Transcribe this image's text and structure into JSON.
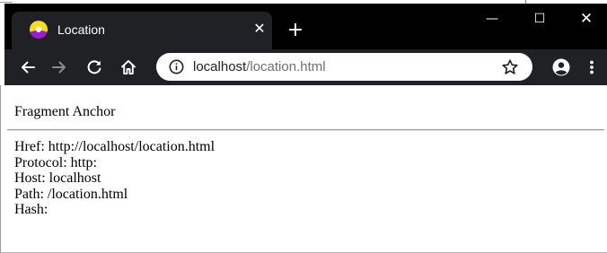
{
  "browser": {
    "tab": {
      "title": "Location",
      "favicon": "color-wheel-icon",
      "close_icon": "close-icon"
    },
    "new_tab_icon": "plus-icon",
    "window_controls": {
      "minimize": "—",
      "maximize": "☐",
      "close": "✕"
    },
    "toolbar": {
      "back_icon": "arrow-left-icon",
      "forward_icon": "arrow-right-icon",
      "reload_icon": "reload-icon",
      "home_icon": "home-icon",
      "info_icon": "info-icon",
      "bookmark_icon": "star-icon",
      "profile_icon": "account-circle-icon",
      "menu_icon": "vertical-dots-icon"
    },
    "address_bar": {
      "host": "localhost",
      "path": "/location.html"
    },
    "colors": {
      "titlebar": "#000000",
      "toolbar": "#202124",
      "omnibox": "#ffffff",
      "favicon_yellow": "#f7dd2b",
      "favicon_purple": "#9b1fc4"
    }
  },
  "page": {
    "fragment_anchor": "Fragment Anchor",
    "location_info": [
      {
        "key": "href",
        "text": "Href: http://localhost/location.html"
      },
      {
        "key": "protocol",
        "text": "Protocol: http:"
      },
      {
        "key": "host",
        "text": "Host: localhost"
      },
      {
        "key": "path",
        "text": "Path: /location.html"
      },
      {
        "key": "hash",
        "text": "Hash:"
      }
    ]
  }
}
